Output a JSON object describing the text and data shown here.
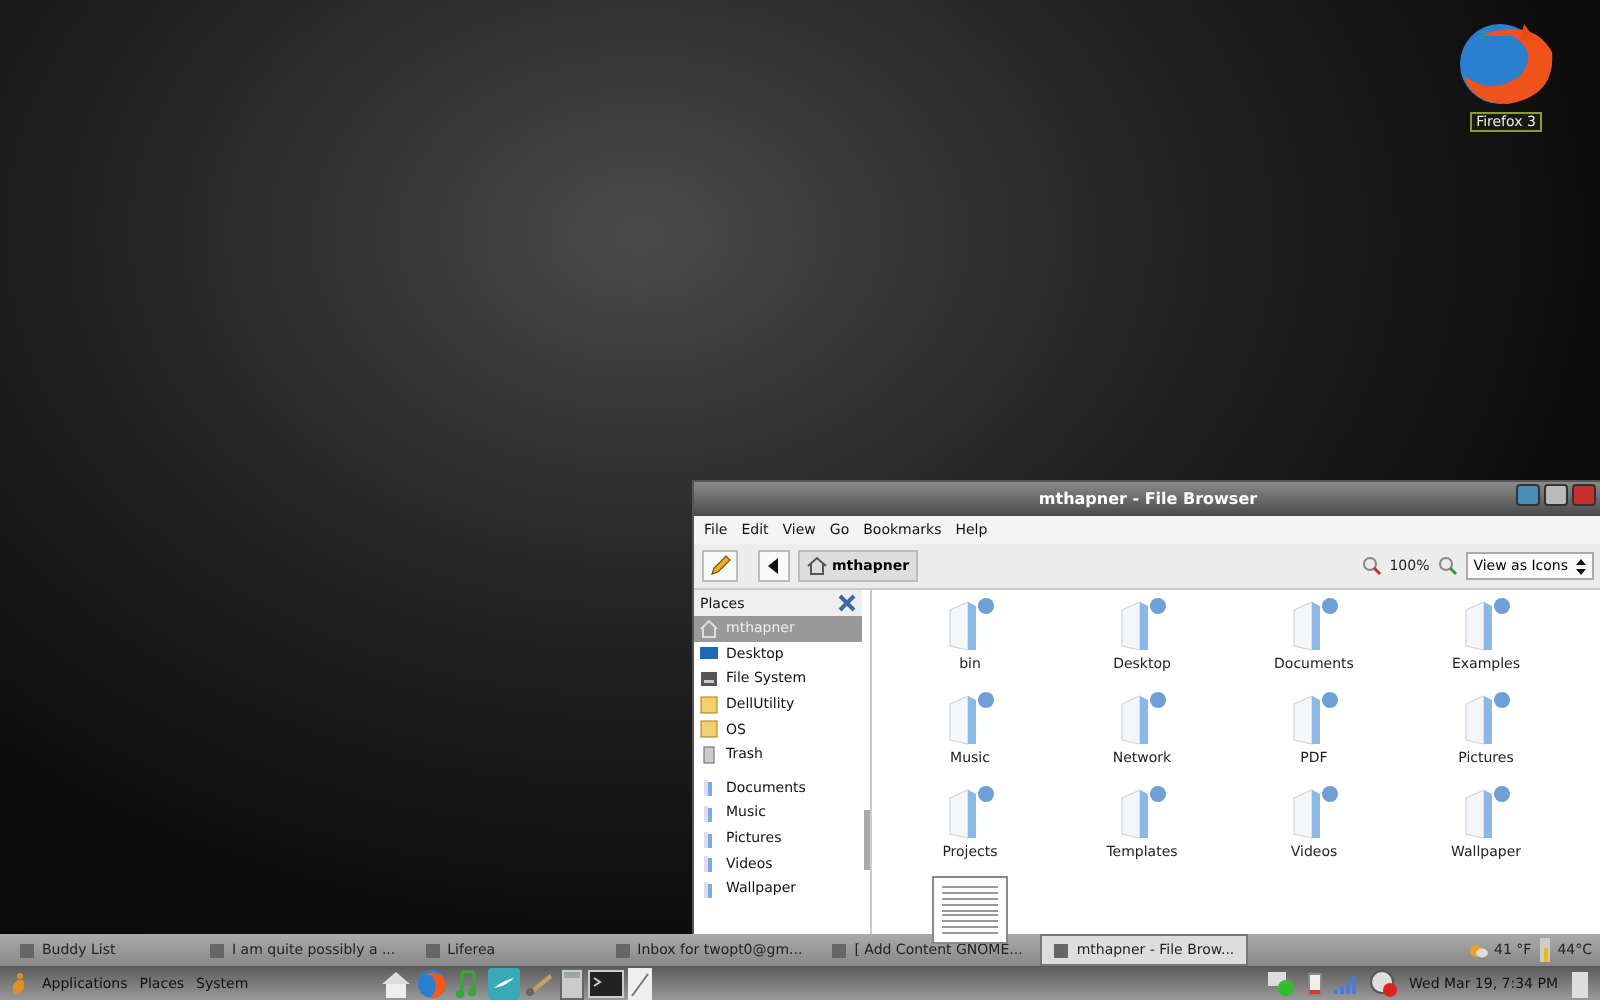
{
  "desktop_icons": [
    {
      "label": "Firefox 3"
    }
  ],
  "window": {
    "title": "mthapner - File Browser",
    "menu": [
      "File",
      "Edit",
      "View",
      "Go",
      "Bookmarks",
      "Help"
    ],
    "toolbar": {
      "location": "mthapner",
      "zoom": "100%",
      "view": "View as Icons"
    },
    "sidebar": {
      "title": "Places",
      "items": [
        {
          "label": "mthapner",
          "kind": "home",
          "selected": true
        },
        {
          "label": "Desktop",
          "kind": "desktop",
          "selected": false
        },
        {
          "label": "File System",
          "kind": "drive",
          "selected": false
        },
        {
          "label": "DellUtility",
          "kind": "volume",
          "selected": false
        },
        {
          "label": "OS",
          "kind": "volume",
          "selected": false
        },
        {
          "label": "Trash",
          "kind": "trash",
          "selected": false
        },
        {
          "label": "Documents",
          "kind": "bookmark",
          "selected": false
        },
        {
          "label": "Music",
          "kind": "bookmark",
          "selected": false
        },
        {
          "label": "Pictures",
          "kind": "bookmark",
          "selected": false
        },
        {
          "label": "Videos",
          "kind": "bookmark",
          "selected": false
        },
        {
          "label": "Wallpaper",
          "kind": "bookmark",
          "selected": false
        }
      ]
    },
    "files": [
      {
        "name": "bin",
        "kind": "folder"
      },
      {
        "name": "Desktop",
        "kind": "folder"
      },
      {
        "name": "Documents",
        "kind": "folder"
      },
      {
        "name": "Examples",
        "kind": "folder"
      },
      {
        "name": "Music",
        "kind": "folder"
      },
      {
        "name": "Network",
        "kind": "folder"
      },
      {
        "name": "PDF",
        "kind": "folder"
      },
      {
        "name": "Pictures",
        "kind": "folder"
      },
      {
        "name": "Projects",
        "kind": "folder"
      },
      {
        "name": "Templates",
        "kind": "folder"
      },
      {
        "name": "Videos",
        "kind": "folder"
      },
      {
        "name": "Wallpaper",
        "kind": "folder"
      },
      {
        "kind": "document"
      }
    ]
  },
  "taskbar": [
    {
      "label": "Buddy List",
      "selected": false
    },
    {
      "label": "I am quite possibly a ...",
      "selected": false
    },
    {
      "label": "Liferea",
      "selected": false
    },
    {
      "label": "Inbox for twopt0@gm...",
      "selected": false
    },
    {
      "label": "[ Add Content GNOME...",
      "selected": false
    },
    {
      "label": "mthapner - File Brow...",
      "selected": true
    }
  ],
  "weather": {
    "temperature": "41 °F",
    "cpu_temperature": "44°C"
  },
  "panel": {
    "menus": [
      "Applications",
      "Places",
      "System"
    ],
    "clock": "Wed Mar 19,  7:34 PM"
  }
}
